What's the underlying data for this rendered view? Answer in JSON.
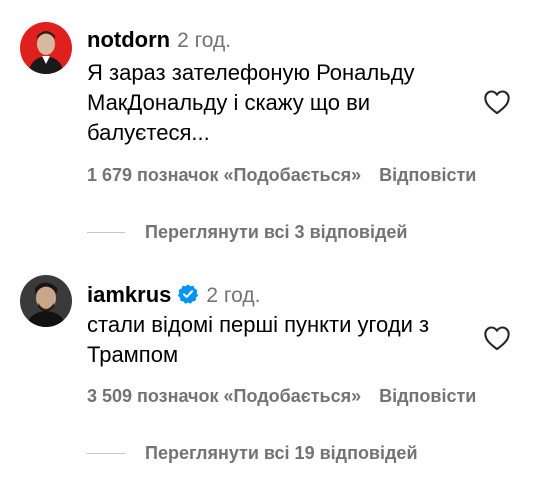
{
  "comments": [
    {
      "username": "notdorn",
      "verified": false,
      "time": "2 год.",
      "text": "Я зараз зателефоную Рональду\nМакДональду і скажу що ви\nбалуєтеся...",
      "likes": "1 679 позначок «Подобається»",
      "reply_label": "Відповісти",
      "view_replies": "Переглянути всі 3 відповідей",
      "like_icon": "heart-outline-icon"
    },
    {
      "username": "iamkrus",
      "verified": true,
      "verified_color": "#0095f6",
      "time": "2 год.",
      "text": "стали відомі перші пункти угоди з\nТрампом",
      "likes": "3 509 позначок «Подобається»",
      "reply_label": "Відповісти",
      "view_replies": "Переглянути всі 19 відповідей",
      "like_icon": "heart-outline-icon"
    }
  ],
  "colors": {
    "secondary_text": "#737373",
    "avatar1_bg": "#e0201f",
    "avatar2_bg": "#3a3a3a"
  }
}
